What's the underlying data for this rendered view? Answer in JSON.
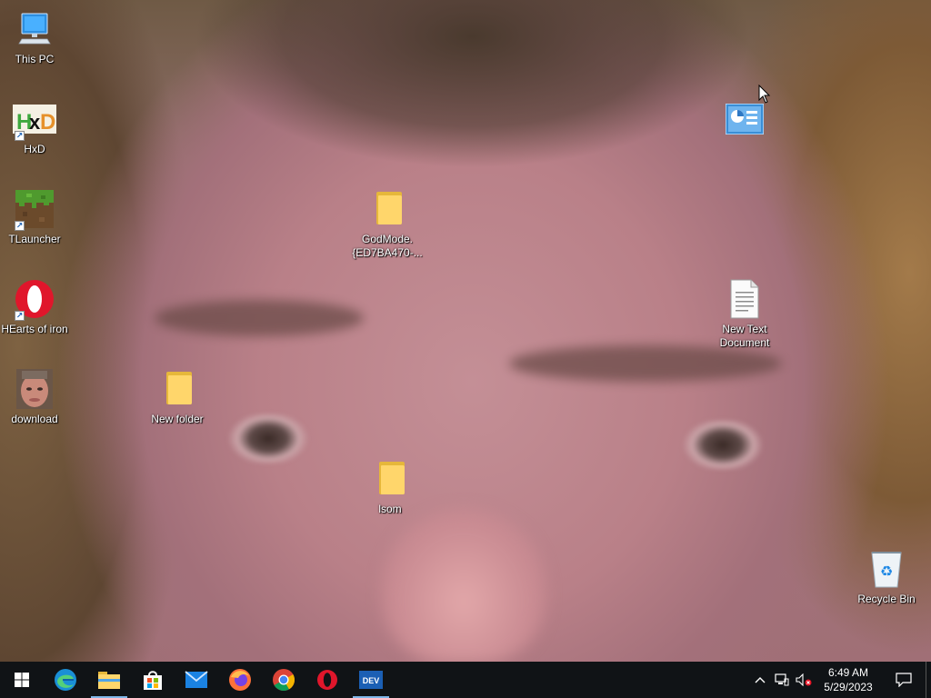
{
  "desktop": {
    "icons": [
      {
        "label": "This PC"
      },
      {
        "label": "HxD"
      },
      {
        "label": "TLauncher"
      },
      {
        "label": "HEarts of iron"
      },
      {
        "label": "download"
      },
      {
        "label": "New folder"
      },
      {
        "label": "GodMode.\n{ED7BA470-..."
      },
      {
        "label": "lsom"
      },
      {
        "label": "New Text\nDocument"
      },
      {
        "label": "Recycle Bin"
      }
    ],
    "unlabeled_icon": "control-panel-icon"
  },
  "taskbar": {
    "apps": [
      "start-icon",
      "edge-icon",
      "file-explorer-icon",
      "store-icon",
      "mail-icon",
      "firefox-icon",
      "chrome-icon",
      "opera-icon",
      "dev-icon"
    ],
    "dev_label": "DEV",
    "clock": {
      "time": "6:49 AM",
      "date": "5/29/2023"
    },
    "colors": {
      "background": "#101316",
      "active_indicator": "#7fb6e8"
    }
  }
}
